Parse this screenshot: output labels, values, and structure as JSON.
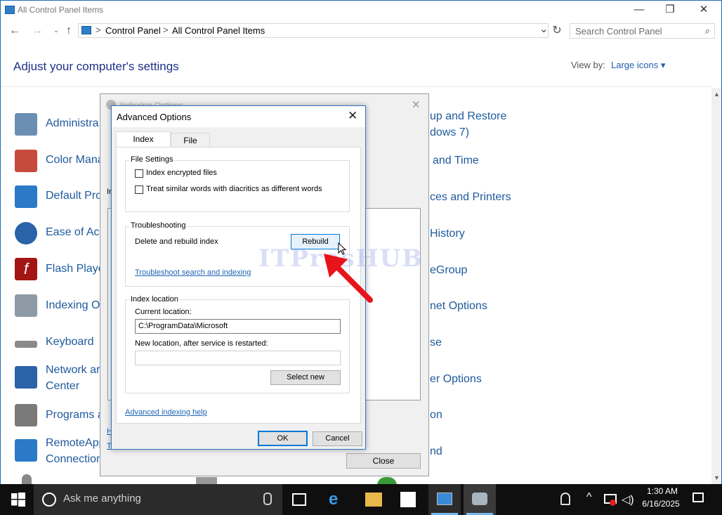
{
  "window": {
    "title": "All Control Panel Items",
    "minimize": "—",
    "restore": "❐",
    "close": "✕"
  },
  "address": {
    "back": "←",
    "forward": "→",
    "up": "↑",
    "crumbs": [
      "Control Panel",
      "All Control Panel Items"
    ],
    "separator": ">",
    "dropdown": "⌄",
    "refresh": "↻"
  },
  "search": {
    "placeholder": "Search Control Panel"
  },
  "header": {
    "title": "Adjust your computer's settings",
    "view_by_label": "View by:",
    "view_by_value": "Large icons ▾"
  },
  "items_left": [
    {
      "label": "Administra",
      "color": "#6b8fb3"
    },
    {
      "label": "Color Mana",
      "color": "#c84a3d"
    },
    {
      "label": "Default Pro",
      "color": "#2a7ac7"
    },
    {
      "label": "Ease of Acc",
      "color": "#2a63a8"
    },
    {
      "label": "Flash Playe",
      "color": "#a31515"
    },
    {
      "label": "Indexing O",
      "color": "#8e9aa6"
    },
    {
      "label": "Keyboard",
      "color": "#8a8a8a"
    },
    {
      "label": "Network ar",
      "label2": "Center",
      "color": "#2a63a8"
    },
    {
      "label": "Programs a",
      "color": "#7a7a7a"
    },
    {
      "label": "RemoteApp",
      "label2": "Connection",
      "color": "#2a7ac7"
    }
  ],
  "items_right": [
    {
      "label": "up and Restore",
      "label2": "dows 7)"
    },
    {
      "label": "and Time"
    },
    {
      "label": "ces and Printers"
    },
    {
      "label": "History"
    },
    {
      "label": "eGroup"
    },
    {
      "label": "net Options"
    },
    {
      "label": "se"
    },
    {
      "label": "er Options"
    },
    {
      "label": "on"
    },
    {
      "label": "nd"
    }
  ],
  "indexing_window": {
    "title": "Indexing Options",
    "close_label": "Close",
    "partial_label": "In",
    "link1": "H",
    "link2": "T"
  },
  "advanced": {
    "title": "Advanced Options",
    "tabs": [
      "Index Settings",
      "File Types"
    ],
    "file_settings": {
      "label": "File Settings",
      "options": [
        "Index encrypted files",
        "Treat similar words with diacritics as different words"
      ]
    },
    "troubleshooting": {
      "label": "Troubleshooting",
      "delete_text": "Delete and rebuild index",
      "rebuild_button": "Rebuild",
      "link": "Troubleshoot search and indexing"
    },
    "index_location": {
      "label": "Index location",
      "current_label": "Current location:",
      "current_value": "C:\\ProgramData\\Microsoft",
      "new_label": "New location, after service is restarted:",
      "new_value": "",
      "select_button": "Select new"
    },
    "help_link": "Advanced indexing help",
    "ok": "OK",
    "cancel": "Cancel"
  },
  "watermark": "ITProsHUB",
  "taskbar": {
    "search_text": "Ask me anything",
    "time": "1:30 AM",
    "date": "6/16/2025"
  },
  "colors": {
    "link_blue": "#1e5a9c",
    "accent": "#2b79c7",
    "arrow_red": "#e8141b"
  }
}
